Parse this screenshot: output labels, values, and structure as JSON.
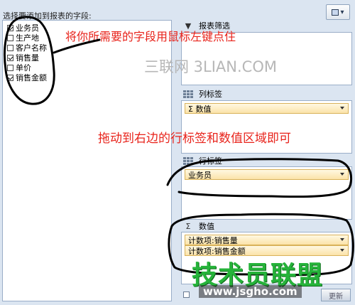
{
  "field_panel": {
    "title": "选择要添加到报表的字段:",
    "fields": [
      {
        "label": "业务员",
        "checked": true
      },
      {
        "label": "生产地",
        "checked": false
      },
      {
        "label": "客户名称",
        "checked": false
      },
      {
        "label": "销售量",
        "checked": true
      },
      {
        "label": "单价",
        "checked": false
      },
      {
        "label": "销售金额",
        "checked": true
      }
    ]
  },
  "layout_button": {
    "icon": "layout-options-icon",
    "label": "▾"
  },
  "report_filter": {
    "label": "报表筛选",
    "icon": "filter-icon"
  },
  "column_labels": {
    "label": "列标签",
    "icon": "columns-icon",
    "items": [
      "Σ 数值"
    ]
  },
  "row_labels": {
    "label": "行标签",
    "icon": "rows-icon",
    "items": [
      "业务员"
    ]
  },
  "values": {
    "label": "数值",
    "icon": "sigma-icon",
    "items": [
      "计数项:销售量",
      "计数项:销售金额"
    ]
  },
  "bottom": {
    "update_label": "更新"
  },
  "annotations": {
    "drag_hint": "将你所需要的字段用鼠标左键点住",
    "drop_hint": "拖动到右边的行标签和数值区域即可"
  },
  "watermarks": {
    "top": "三联网 3LIAN.COM",
    "brand": "技术员联盟",
    "url": "www.jsgho.com"
  },
  "colors": {
    "panel_bg": "#dbe5f1",
    "pill_bg": "#fbe3a9",
    "annotation_red": "#e8231b",
    "watermark_green": "#26b33a"
  }
}
